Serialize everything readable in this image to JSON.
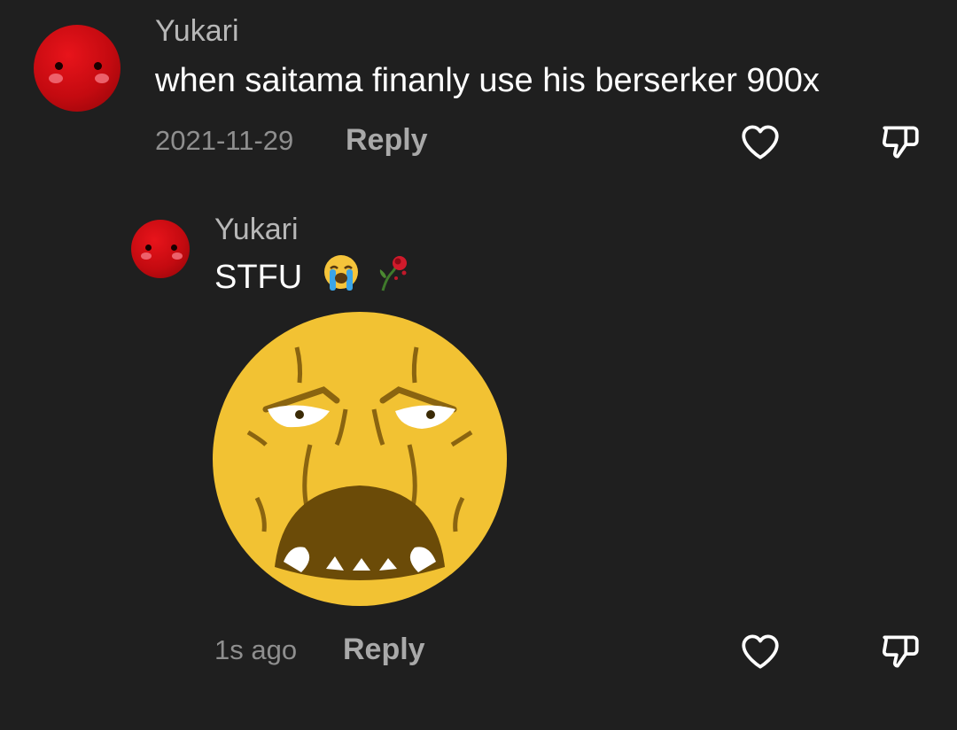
{
  "comments": [
    {
      "username": "Yukari",
      "text": "when saitama finanly use his berserker 900x",
      "date": "2021-11-29",
      "reply_label": "Reply",
      "like_icon": "heart-outline-icon",
      "dislike_icon": "thumbs-down-outline-icon"
    },
    {
      "username": "Yukari",
      "text": "STFU",
      "emojis": [
        "loudly-crying-face",
        "wilted-rose"
      ],
      "sticker": "angry-screaming-face-sticker",
      "date": "1s ago",
      "reply_label": "Reply",
      "like_icon": "heart-outline-icon",
      "dislike_icon": "thumbs-down-outline-icon"
    }
  ],
  "colors": {
    "background": "#1f1f1f",
    "username": "#b7b7b7",
    "text": "#ffffff",
    "meta": "#8f8f8f",
    "avatar": "#d40d12",
    "sticker": "#f2c233"
  }
}
